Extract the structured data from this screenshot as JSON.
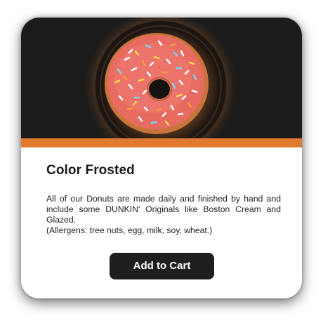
{
  "product": {
    "title": "Color Frosted",
    "description_body": "All of our Donuts are made daily and finished by hand and include some DUNKIN' Originals like Boston Cream and Glazed.",
    "description_allergens": "(Allergens: tree nuts, egg, milk, soy, wheat.)",
    "image_alt": "donut with pink frosting and rainbow sprinkles"
  },
  "actions": {
    "add_to_cart_label": "Add to Cart"
  },
  "colors": {
    "hero_background": "#1c1c1c",
    "accent_band": "#e07a2e",
    "button_background": "#1f1f1f",
    "button_text": "#ffffff",
    "frosting": "#e86b62",
    "dough": "#d9884a"
  }
}
